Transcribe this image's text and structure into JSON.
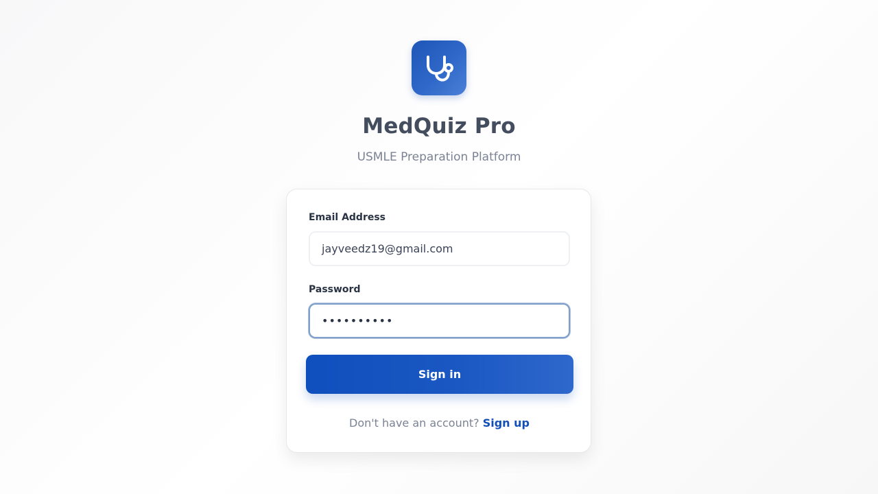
{
  "brand": {
    "logo_icon": "stethoscope-icon",
    "title": "MedQuiz Pro",
    "subtitle": "USMLE Preparation Platform",
    "accent_color": "#1a57c2"
  },
  "login_form": {
    "email_label": "Email Address",
    "email_value": "jayveedz19@gmail.com",
    "password_label": "Password",
    "password_value_masked": "••••••••••",
    "submit_label": "Sign in",
    "signup_prompt": "Don't have an account?",
    "signup_link": "Sign up"
  }
}
